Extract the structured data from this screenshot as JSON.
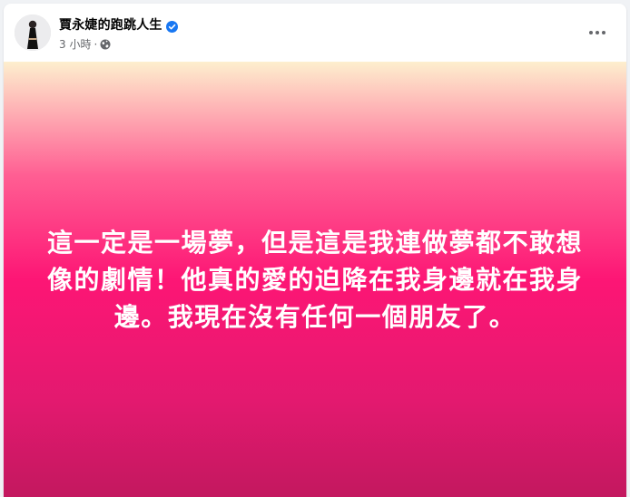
{
  "post": {
    "author": "賈永婕的跑跳人生",
    "verified_icon": "verified-badge-icon",
    "verified_color": "#1877f2",
    "time": "3 小時",
    "separator": "·",
    "audience_icon": "globe-icon",
    "more_icon": "more-options-icon",
    "status_text": "這一定是一場夢，但是這是我連做夢都不敢想像的劇情！他真的愛的迫降在我身邊就在我身邊。我現在沒有任何一個朋友了。",
    "gradient_colors": [
      "#fdefce",
      "#ff5f93",
      "#fd1675",
      "#e3196f",
      "#c3185f"
    ],
    "text_color": "#ffffff"
  }
}
